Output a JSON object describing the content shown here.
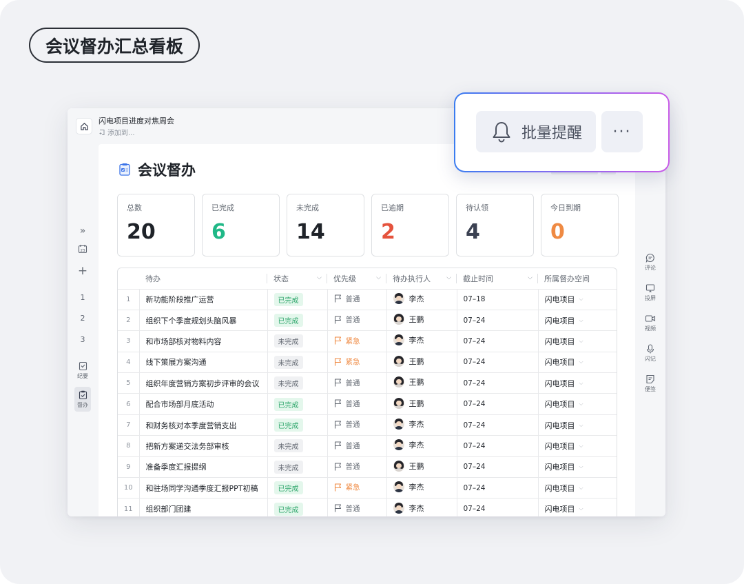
{
  "banner_title": "会议督办汇总看板",
  "doc": {
    "title": "闪电项目进度对焦周会",
    "sub": "添加到..."
  },
  "left_rail": {
    "expand": "»",
    "add": "+",
    "pages": [
      "1",
      "2",
      "3"
    ],
    "minutes_label": "纪要",
    "supervise_label": "督办"
  },
  "right_rail": {
    "items": [
      "评论",
      "投屏",
      "视频",
      "闪记",
      "便签"
    ]
  },
  "page_heading": "会议督办",
  "stats": [
    {
      "label": "总数",
      "value": "20",
      "color": "#1f2329"
    },
    {
      "label": "已完成",
      "value": "6",
      "color": "#20b887"
    },
    {
      "label": "未完成",
      "value": "14",
      "color": "#1f2329"
    },
    {
      "label": "已逾期",
      "value": "2",
      "color": "#e5533d"
    },
    {
      "label": "待认领",
      "value": "4",
      "color": "#3b4152"
    },
    {
      "label": "今日到期",
      "value": "0",
      "color": "#ef8a43"
    }
  ],
  "table": {
    "headers": [
      "待办",
      "状态",
      "优先级",
      "待办执行人",
      "截止时间",
      "所属督办空间"
    ],
    "rows": [
      {
        "n": "1",
        "task": "新功能阶段推广运营",
        "status": "已完成",
        "prio": "普通",
        "person": "李杰",
        "date": "07–18",
        "space": "闪电项目"
      },
      {
        "n": "2",
        "task": "组织下个季度规划头脑风暴",
        "status": "已完成",
        "prio": "普通",
        "person": "王鹏",
        "date": "07–24",
        "space": "闪电项目"
      },
      {
        "n": "3",
        "task": "和市场部核对物料内容",
        "status": "未完成",
        "prio": "紧急",
        "person": "李杰",
        "date": "07–24",
        "space": "闪电项目"
      },
      {
        "n": "4",
        "task": "线下策展方案沟通",
        "status": "未完成",
        "prio": "紧急",
        "person": "王鹏",
        "date": "07–24",
        "space": "闪电项目"
      },
      {
        "n": "5",
        "task": "组织年度营销方案初步评审的会议",
        "status": "未完成",
        "prio": "普通",
        "person": "王鹏",
        "date": "07–24",
        "space": "闪电项目"
      },
      {
        "n": "6",
        "task": "配合市场部月底活动",
        "status": "已完成",
        "prio": "普通",
        "person": "王鹏",
        "date": "07–24",
        "space": "闪电项目"
      },
      {
        "n": "7",
        "task": "和财务核对本季度营销支出",
        "status": "已完成",
        "prio": "普通",
        "person": "李杰",
        "date": "07–24",
        "space": "闪电项目"
      },
      {
        "n": "8",
        "task": "把新方案递交法务部审核",
        "status": "未完成",
        "prio": "普通",
        "person": "李杰",
        "date": "07–24",
        "space": "闪电项目"
      },
      {
        "n": "9",
        "task": "准备季度汇报提纲",
        "status": "未完成",
        "prio": "普通",
        "person": "王鹏",
        "date": "07–24",
        "space": "闪电项目"
      },
      {
        "n": "10",
        "task": "和驻场同学沟通季度汇报PPT初稿",
        "status": "已完成",
        "prio": "紧急",
        "person": "李杰",
        "date": "07–24",
        "space": "闪电项目"
      },
      {
        "n": "11",
        "task": "组织部门团建",
        "status": "已完成",
        "prio": "普通",
        "person": "李杰",
        "date": "07–24",
        "space": "闪电项目"
      }
    ]
  },
  "popover": {
    "batch_label": "批量提醒",
    "more_label": "···"
  }
}
